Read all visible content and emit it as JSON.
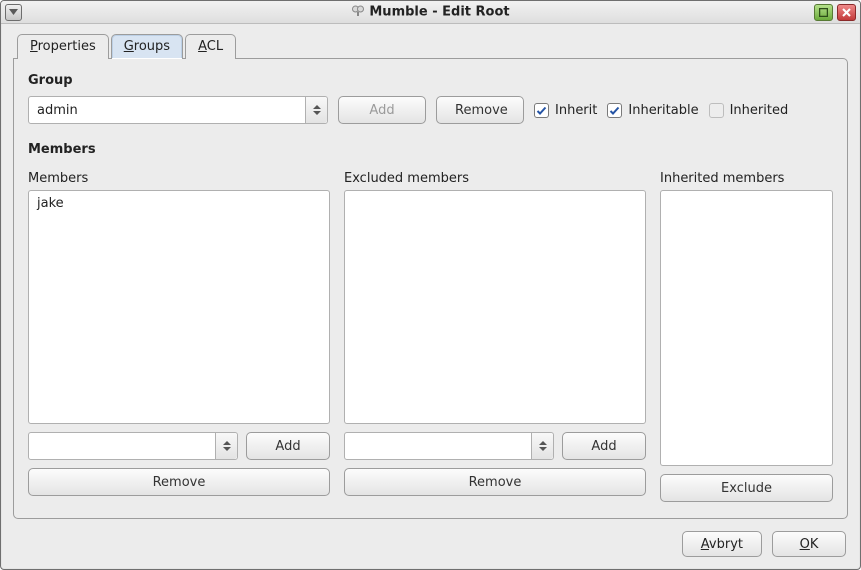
{
  "window": {
    "title": "Mumble - Edit Root"
  },
  "tabs": {
    "properties": "Properties",
    "groups": "Groups",
    "acl": "ACL",
    "active": "groups"
  },
  "group_section": {
    "header": "Group",
    "combo_value": "admin",
    "add_label": "Add",
    "remove_label": "Remove",
    "inherit_label": "Inherit",
    "inherit_checked": true,
    "inheritable_label": "Inheritable",
    "inheritable_checked": true,
    "inherited_label": "Inherited",
    "inherited_checked": false,
    "inherited_enabled": false
  },
  "members_section": {
    "header": "Members",
    "cols": {
      "members": {
        "label": "Members",
        "items": [
          "jake"
        ],
        "input_value": "",
        "add_label": "Add",
        "remove_label": "Remove"
      },
      "excluded": {
        "label": "Excluded members",
        "items": [],
        "input_value": "",
        "add_label": "Add",
        "remove_label": "Remove"
      },
      "inherited": {
        "label": "Inherited members",
        "items": [],
        "exclude_label": "Exclude"
      }
    }
  },
  "footer": {
    "cancel": "Avbryt",
    "ok": "OK"
  }
}
